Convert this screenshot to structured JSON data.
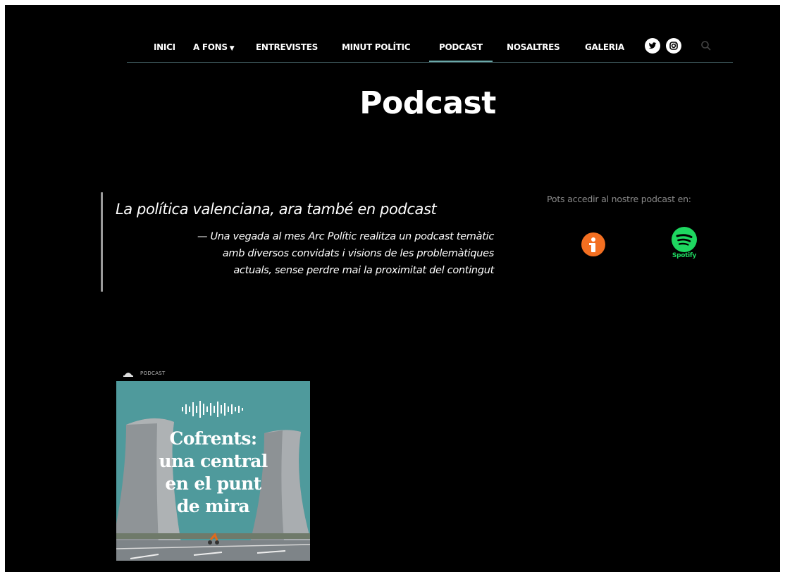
{
  "nav": {
    "items": [
      {
        "label": "INICI"
      },
      {
        "label": "A FONS",
        "has_dropdown": true
      },
      {
        "label": "ENTREVISTES"
      },
      {
        "label": "MINUT POLÍTIC"
      },
      {
        "label": "PODCAST",
        "active": true
      },
      {
        "label": "NOSALTRES"
      },
      {
        "label": "GALERIA"
      }
    ],
    "icons": [
      "twitter-icon",
      "instagram-icon",
      "search-icon"
    ]
  },
  "page": {
    "title": "Podcast"
  },
  "quote": {
    "heading": "La política valenciana, ara també en podcast",
    "lines": [
      "— Una vegada al mes Arc Polític realitza un podcast temàtic",
      "amb diversos convidats i visions de les problemàtiques",
      "actuals, sense perdre mai la proximitat del contingut"
    ]
  },
  "sidebar": {
    "label": "Pots accedir al nostre podcast en:",
    "platforms": [
      {
        "name": "ivoox",
        "icon": "ivoox-icon",
        "color": "#f36f21"
      },
      {
        "name": "Spotify",
        "label": "Spotify",
        "icon": "spotify-icon",
        "color": "#1ed760"
      }
    ]
  },
  "card": {
    "category": "PODCAST",
    "title_lines": [
      "Cofrents:",
      "una central",
      "en el punt",
      "de mira"
    ],
    "background_color": "#4f9a9c"
  }
}
